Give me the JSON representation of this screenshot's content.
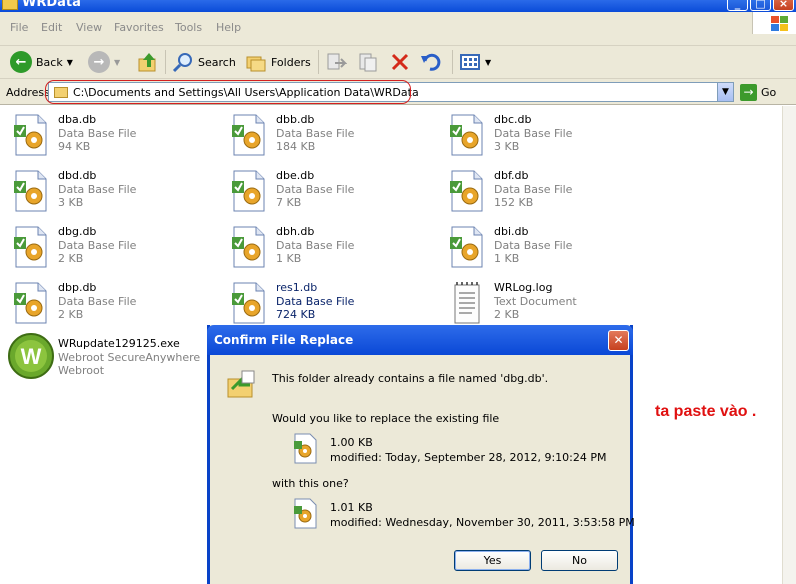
{
  "window": {
    "title": "WRData"
  },
  "menu": [
    "File",
    "Edit",
    "View",
    "Favorites",
    "Tools",
    "Help"
  ],
  "toolbar": {
    "back_label": "Back",
    "search_label": "Search",
    "folders_label": "Folders"
  },
  "address": {
    "label": "Address",
    "path": "C:\\Documents and Settings\\All Users\\Application Data\\WRData",
    "go_label": "Go"
  },
  "files": [
    {
      "name": "dba.db",
      "type": "Data Base File",
      "size": "94 KB"
    },
    {
      "name": "dbb.db",
      "type": "Data Base File",
      "size": "184 KB"
    },
    {
      "name": "dbc.db",
      "type": "Data Base File",
      "size": "3 KB"
    },
    {
      "name": "dbd.db",
      "type": "Data Base File",
      "size": "3 KB"
    },
    {
      "name": "dbe.db",
      "type": "Data Base File",
      "size": "7 KB"
    },
    {
      "name": "dbf.db",
      "type": "Data Base File",
      "size": "152 KB"
    },
    {
      "name": "dbg.db",
      "type": "Data Base File",
      "size": "2 KB"
    },
    {
      "name": "dbh.db",
      "type": "Data Base File",
      "size": "1 KB"
    },
    {
      "name": "dbi.db",
      "type": "Data Base File",
      "size": "1 KB"
    },
    {
      "name": "dbp.db",
      "type": "Data Base File",
      "size": "2 KB"
    },
    {
      "name": "res1.db",
      "type": "Data Base File",
      "size": "724 KB"
    },
    {
      "name": "WRLog.log",
      "type": "Text Document",
      "size": "2 KB"
    },
    {
      "name": "WRupdate129125.exe",
      "type": "Webroot SecureAnywhere",
      "size": "Webroot"
    }
  ],
  "annotation": "ta paste vào .",
  "dialog": {
    "title": "Confirm File Replace",
    "message": "This folder already contains a file named 'dbg.db'.",
    "question": "Would you like to replace the existing file",
    "existing_size": "1.00 KB",
    "existing_modified": "modified: Today, September 28, 2012, 9:10:24 PM",
    "with_label": "with this one?",
    "new_size": "1.01 KB",
    "new_modified": "modified: Wednesday, November 30, 2011, 3:53:58 PM",
    "yes_label": "Yes",
    "no_label": "No"
  }
}
